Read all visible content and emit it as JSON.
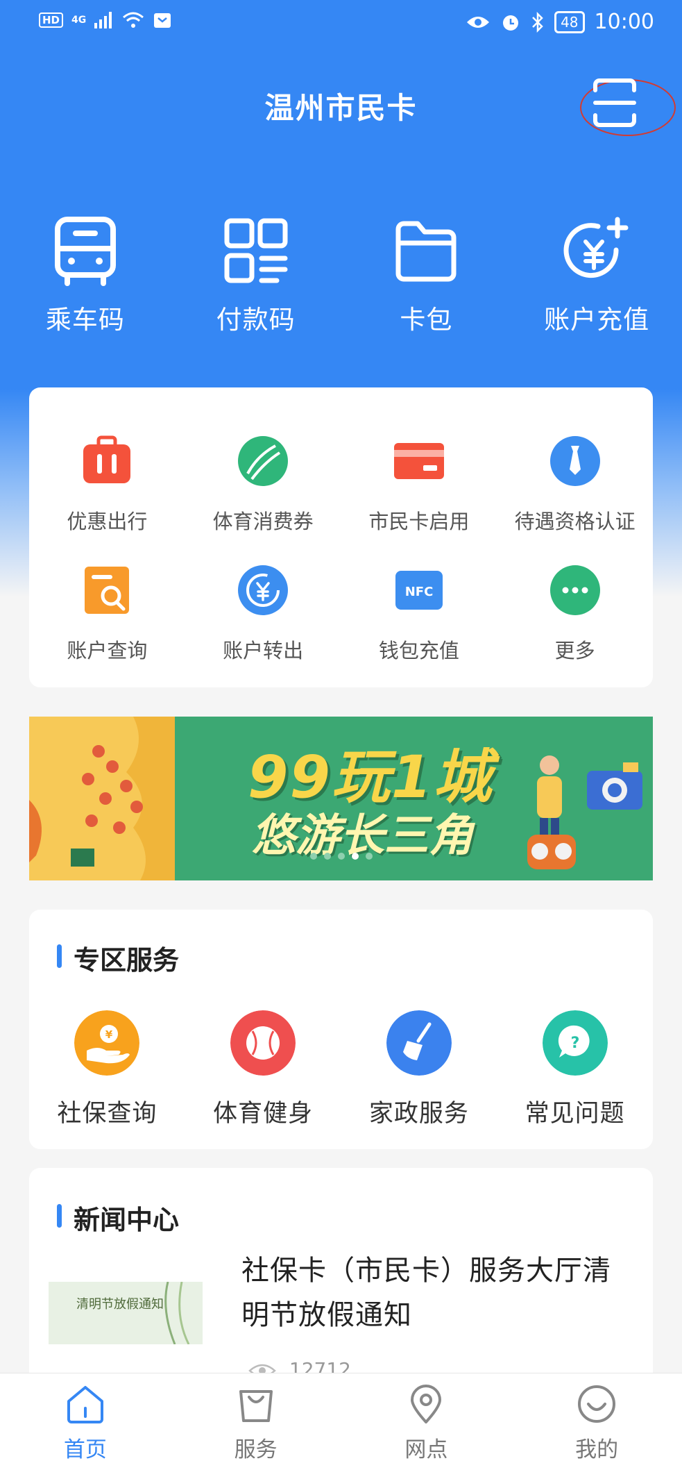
{
  "status_bar": {
    "hd": "HD",
    "network": "4G",
    "battery": "48",
    "time": "10:00"
  },
  "header": {
    "title": "温州市民卡"
  },
  "top_actions": [
    {
      "label": "乘车码",
      "icon": "bus-icon"
    },
    {
      "label": "付款码",
      "icon": "qr-pay-icon"
    },
    {
      "label": "卡包",
      "icon": "folder-icon"
    },
    {
      "label": "账户充值",
      "icon": "yen-plus-icon"
    }
  ],
  "services": [
    {
      "label": "优惠出行",
      "icon": "suitcase-icon",
      "color": "#f4523b"
    },
    {
      "label": "体育消费券",
      "icon": "tennis-ball-icon",
      "color": "#2fb67a"
    },
    {
      "label": "市民卡启用",
      "icon": "card-icon",
      "color": "#f4523b"
    },
    {
      "label": "待遇资格认证",
      "icon": "tie-icon",
      "color": "#3c8ef0"
    },
    {
      "label": "账户查询",
      "icon": "doc-search-icon",
      "color": "#f89a2b"
    },
    {
      "label": "账户转出",
      "icon": "yen-transfer-icon",
      "color": "#3c8ef0"
    },
    {
      "label": "钱包充值",
      "icon": "nfc-icon",
      "color": "#3c8ef0",
      "badge": "NFC"
    },
    {
      "label": "更多",
      "icon": "more-icon",
      "color": "#2fb67a"
    }
  ],
  "banner": {
    "line1": "99玩1城",
    "line2": "悠游长三角",
    "dots": 5,
    "active_dot": 3
  },
  "zone": {
    "title": "专区服务",
    "items": [
      {
        "label": "社保查询",
        "icon": "hand-coin-icon",
        "color": "#f8a21d"
      },
      {
        "label": "体育健身",
        "icon": "baseball-icon",
        "color": "#ef4f4f"
      },
      {
        "label": "家政服务",
        "icon": "broom-icon",
        "color": "#3b82ee"
      },
      {
        "label": "常见问题",
        "icon": "question-icon",
        "color": "#27c2a8"
      }
    ]
  },
  "news": {
    "title": "新闻中心",
    "items": [
      {
        "headline": "社保卡（市民卡）服务大厅清明节放假通知",
        "thumb_text": "清明节放假通知",
        "views": "12712"
      }
    ]
  },
  "tabbar": [
    {
      "label": "首页",
      "icon": "home-icon",
      "active": true
    },
    {
      "label": "服务",
      "icon": "bag-icon",
      "active": false
    },
    {
      "label": "网点",
      "icon": "location-pin-icon",
      "active": false
    },
    {
      "label": "我的",
      "icon": "smile-face-icon",
      "active": false
    }
  ],
  "colors": {
    "brand": "#3587f4",
    "accent_ring": "#d23b32"
  }
}
